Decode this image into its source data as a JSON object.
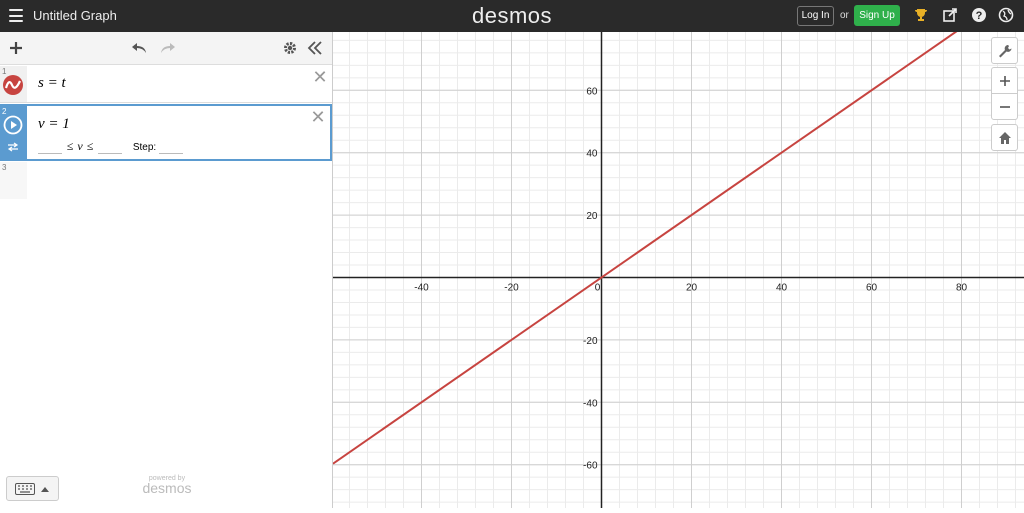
{
  "header": {
    "title": "Untitled Graph",
    "brand": "desmos",
    "login_label": "Log In",
    "or_label": "or",
    "signup_label": "Sign Up"
  },
  "expressions": [
    {
      "index": "1",
      "latex_text": "s = t"
    },
    {
      "index": "2",
      "latex_text": "v = 1",
      "slider": {
        "le1": "≤",
        "var": "v",
        "le2": "≤",
        "step_label": "Step:"
      }
    },
    {
      "index": "3"
    }
  ],
  "powered_by": {
    "small": "powered by",
    "big": "desmos"
  },
  "graph": {
    "x_ticks": [
      "-40",
      "-20",
      "0",
      "20",
      "40",
      "60",
      "80"
    ],
    "y_ticks": [
      "60",
      "40",
      "20",
      "-20",
      "-40",
      "-60"
    ],
    "line_color": "#c74440"
  },
  "colors": {
    "topbar": "#2a2a2a",
    "signup": "#2fb04b",
    "accent": "#5b9bd0"
  }
}
